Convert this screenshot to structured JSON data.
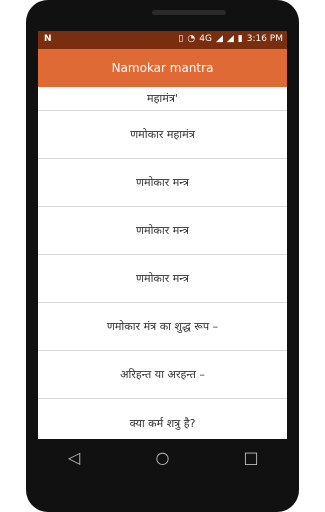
{
  "status": {
    "left_icon": "N",
    "network": "4G",
    "time": "3:16 PM"
  },
  "appbar": {
    "title": "Namokar mantra"
  },
  "list": {
    "items": [
      {
        "label": "महामंत्र'"
      },
      {
        "label": "णमोकार महामंत्र"
      },
      {
        "label": "णमोकार मन्त्र"
      },
      {
        "label": "णमोकार मन्त्र"
      },
      {
        "label": "णमोकार मन्त्र"
      },
      {
        "label": "णमोकार मंत्र का शुद्ध रूप –"
      },
      {
        "label": "अरिहन्त या अरहन्त –"
      },
      {
        "label": "क्या कर्म शत्रु है?"
      }
    ]
  },
  "nav": {
    "back": "◁",
    "home": "○",
    "recents": "□"
  },
  "colors": {
    "statusbar": "#7a2e10",
    "appbar": "#e06a35",
    "divider": "#d9d9d9"
  }
}
